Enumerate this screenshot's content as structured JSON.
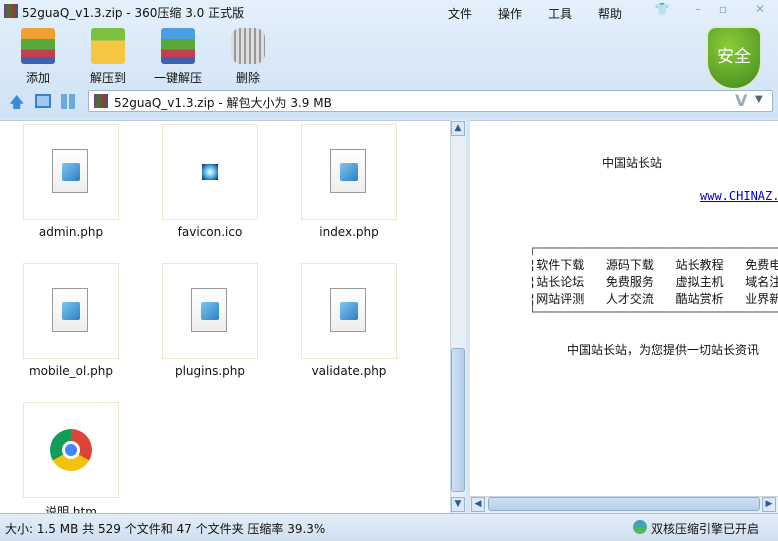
{
  "window": {
    "title": "52guaQ_v1.3.zip - 360压缩 3.0 正式版"
  },
  "menu": [
    "文件",
    "操作",
    "工具",
    "帮助"
  ],
  "toolbar": [
    {
      "label": "添加",
      "icon": "add-archive-icon"
    },
    {
      "label": "解压到",
      "icon": "extract-to-icon"
    },
    {
      "label": "一键解压",
      "icon": "one-click-extract-icon"
    },
    {
      "label": "删除",
      "icon": "trash-icon"
    }
  ],
  "security": {
    "label": "安全",
    "color": "#5aa82a"
  },
  "address": {
    "value": "52guaQ_v1.3.zip - 解包大小为 3.9 MB"
  },
  "files": [
    {
      "name": "admin.php",
      "type": "php"
    },
    {
      "name": "favicon.ico",
      "type": "ico"
    },
    {
      "name": "index.php",
      "type": "php"
    },
    {
      "name": "mobile_ol.php",
      "type": "php"
    },
    {
      "name": "plugins.php",
      "type": "php"
    },
    {
      "name": "validate.php",
      "type": "php"
    },
    {
      "name": "说明.htm",
      "type": "htm"
    }
  ],
  "preview": {
    "heading": "中国站长站",
    "link": "www.CHINAZ.",
    "box_top": "┌──────────────────────────────────────",
    "rows": [
      "¦软件下载   源码下载   站长教程   免费电",
      "¦站长论坛   免费服务   虚拟主机   域名注",
      "¦网站评测   人才交流   酷站赏析   业界新"
    ],
    "box_bottom": "└──────────────────────────────────────",
    "tagline": "中国站长站，为您提供一切站长资讯"
  },
  "status": {
    "summary": "大小: 1.5 MB 共 529 个文件和 47 个文件夹 压缩率 39.3%",
    "engine": "双核压缩引擎已开启"
  }
}
